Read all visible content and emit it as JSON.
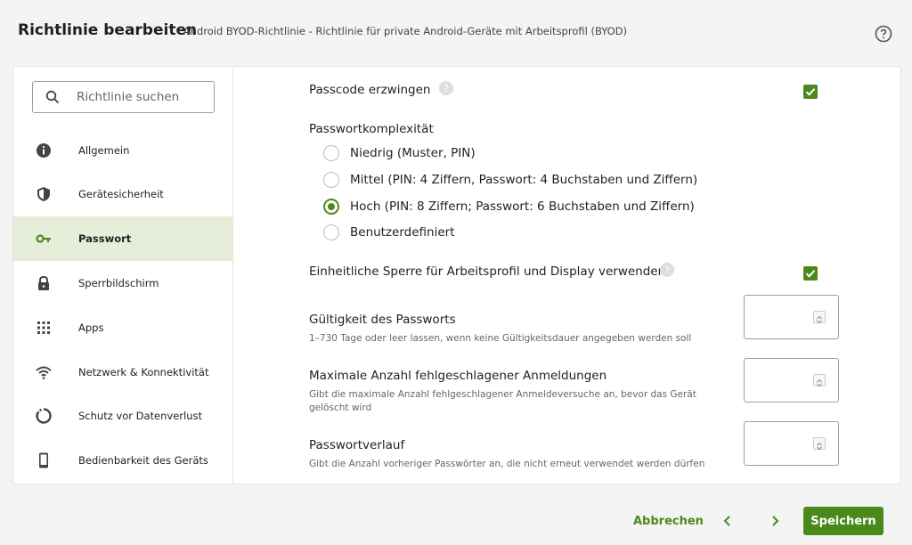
{
  "header": {
    "title": "Richtlinie bearbeiten",
    "subtitle": "-  Android BYOD-Richtlinie - Richtlinie für private Android-Geräte mit Arbeitsprofil (BYOD)"
  },
  "sidebar": {
    "search_placeholder": "Richtlinie suchen",
    "items": [
      {
        "label": "Allgemein",
        "icon": "info-icon"
      },
      {
        "label": "Gerätesicherheit",
        "icon": "shield-icon"
      },
      {
        "label": "Passwort",
        "icon": "key-icon",
        "active": true
      },
      {
        "label": "Sperrbildschirm",
        "icon": "lock-icon"
      },
      {
        "label": "Apps",
        "icon": "apps-grid-icon"
      },
      {
        "label": "Netzwerk & Konnektivität",
        "icon": "wifi-icon"
      },
      {
        "label": "Schutz vor Datenverlust",
        "icon": "data-loss-icon"
      },
      {
        "label": "Bedienbarkeit des Geräts",
        "icon": "phone-icon"
      }
    ]
  },
  "content": {
    "enforce_passcode": {
      "label": "Passcode erzwingen",
      "checked": true
    },
    "complexity": {
      "label": "Passwortkomplexität",
      "options": [
        {
          "label": "Niedrig (Muster, PIN)",
          "selected": false
        },
        {
          "label": "Mittel (PIN: 4 Ziffern, Passwort: 4 Buchstaben und Ziffern)",
          "selected": false
        },
        {
          "label": "Hoch (PIN: 8 Ziffern; Passwort: 6 Buchstaben und Ziffern)",
          "selected": true
        },
        {
          "label": "Benutzerdefiniert",
          "selected": false
        }
      ]
    },
    "unified_lock": {
      "label": "Einheitliche Sperre für Arbeitsprofil und Display verwenden",
      "checked": true
    },
    "expiry": {
      "label": "Gültigkeit des Passworts",
      "help": "1–730 Tage oder leer lassen, wenn keine Gültigkeitsdauer angegeben werden soll",
      "value": ""
    },
    "max_failed": {
      "label": "Maximale Anzahl fehlgeschlagener Anmeldungen",
      "help": "Gibt die maximale Anzahl fehlgeschlagener Anmeldeversuche an, bevor das Gerät gelöscht wird",
      "value": ""
    },
    "history": {
      "label": "Passwortverlauf",
      "help": "Gibt die Anzahl vorheriger Passwörter an, die nicht erneut verwendet werden dürfen",
      "value": ""
    }
  },
  "footer": {
    "cancel": "Abbrechen",
    "save": "Speichern"
  },
  "colors": {
    "accent": "#4a8a1c",
    "active_bg": "#e6eed9"
  }
}
